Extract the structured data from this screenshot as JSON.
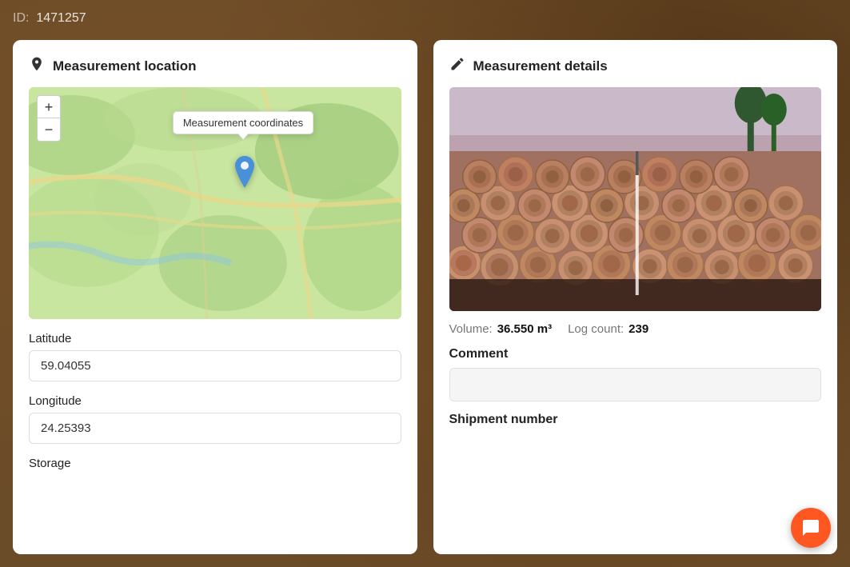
{
  "page": {
    "id_label": "ID:",
    "id_value": "1471257",
    "background_color": "#6b4c28"
  },
  "left_panel": {
    "title": "Measurement location",
    "icon": "📍",
    "map_tooltip": "Measurement coordinates",
    "zoom_plus": "+",
    "zoom_minus": "−",
    "latitude_label": "Latitude",
    "latitude_value": "59.04055",
    "longitude_label": "Longitude",
    "longitude_value": "24.25393",
    "storage_label": "Storage"
  },
  "right_panel": {
    "title": "Measurement details",
    "icon": "✏️",
    "volume_label": "Volume:",
    "volume_value": "36.550 m³",
    "log_count_label": "Log count:",
    "log_count_value": "239",
    "comment_label": "Comment",
    "comment_placeholder": "",
    "shipment_label": "Shipment number"
  },
  "chat_button": {
    "label": "Chat"
  }
}
